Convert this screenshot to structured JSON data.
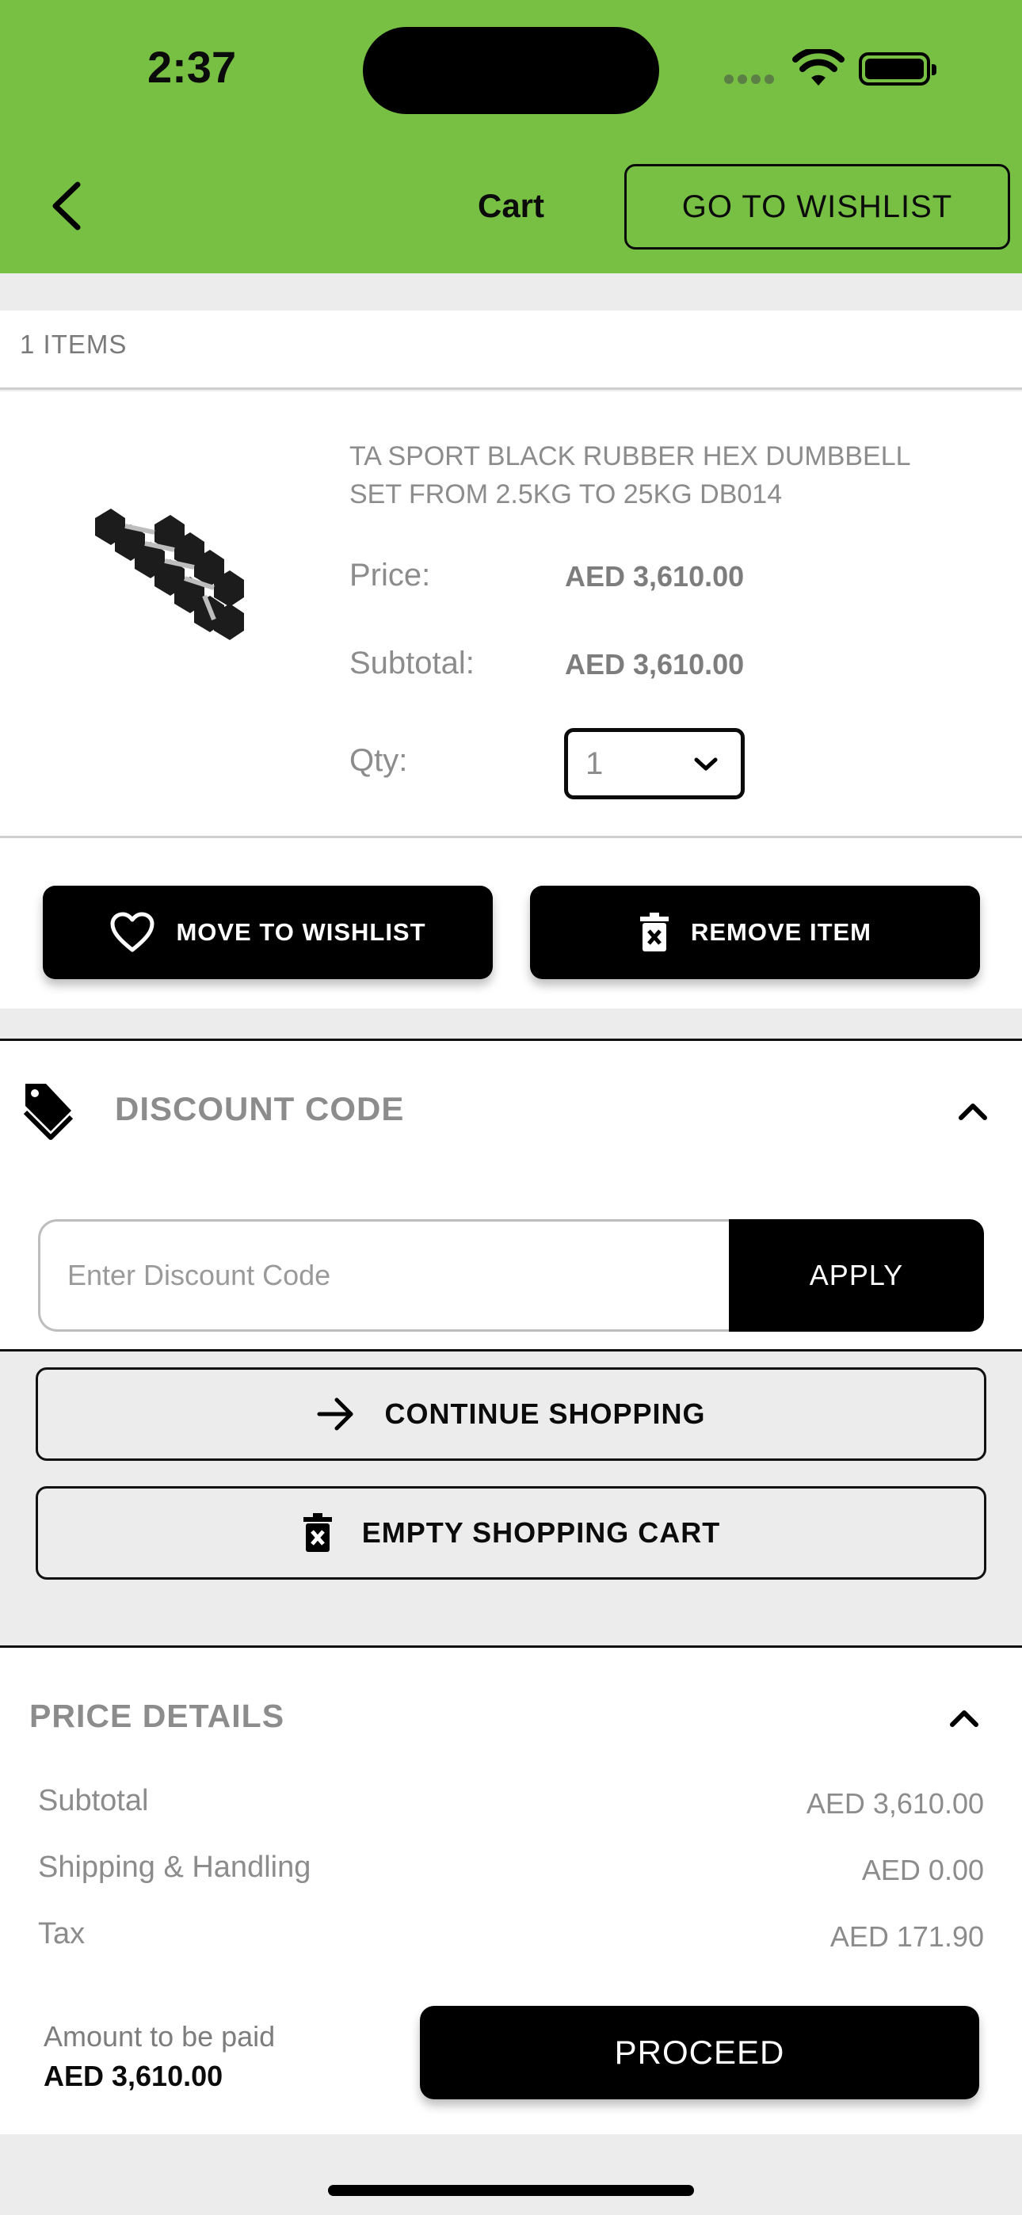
{
  "status_bar": {
    "time": "2:37"
  },
  "header": {
    "title": "Cart",
    "wishlist_button": "GO TO WISHLIST"
  },
  "cart": {
    "items_count_label": "1 ITEMS"
  },
  "product": {
    "name": "TA SPORT BLACK RUBBER HEX DUMBBELL SET FROM 2.5KG TO 25KG DB014",
    "price_label": "Price:",
    "price_value": "AED 3,610.00",
    "subtotal_label": "Subtotal:",
    "subtotal_value": "AED 3,610.00",
    "qty_label": "Qty:",
    "qty_value": "1",
    "move_to_wishlist": "MOVE TO WISHLIST",
    "remove_item": "REMOVE ITEM"
  },
  "discount": {
    "title": "DISCOUNT CODE",
    "placeholder": "Enter Discount Code",
    "apply": "APPLY"
  },
  "buttons": {
    "continue_shopping": "CONTINUE SHOPPING",
    "empty_cart": "EMPTY SHOPPING CART"
  },
  "price_details": {
    "title": "PRICE DETAILS",
    "rows": [
      {
        "label": "Subtotal",
        "value": "AED 3,610.00"
      },
      {
        "label": "Shipping & Handling",
        "value": "AED 0.00"
      },
      {
        "label": "Tax",
        "value": "AED 171.90"
      }
    ],
    "amount_label": "Amount to be paid",
    "amount_value": "AED 3,610.00",
    "proceed": "PROCEED"
  },
  "colors": {
    "header_bg": "#77c043",
    "primary_button": "#000000",
    "muted_text": "#8c8c8c"
  },
  "icons": [
    "back-arrow-icon",
    "wifi-icon",
    "battery-icon",
    "heart-icon",
    "trash-icon",
    "tag-icon",
    "chevron-up-icon",
    "chevron-down-icon",
    "arrow-right-icon"
  ]
}
